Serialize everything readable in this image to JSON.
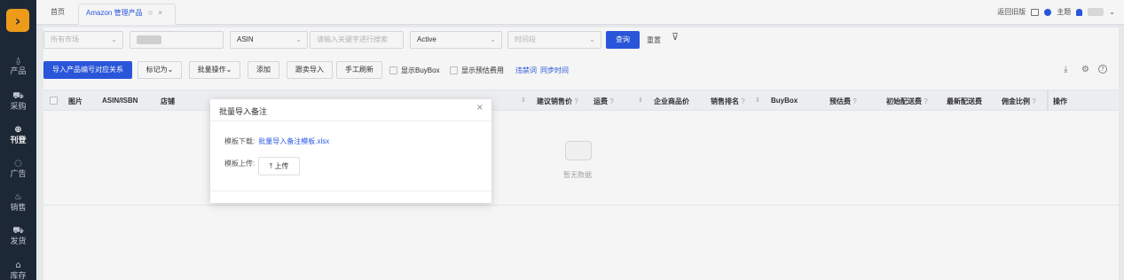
{
  "sidebar": {
    "logo_icon": "brand-logo-icon",
    "items": [
      {
        "label": "产品",
        "icon": "box-icon",
        "glyph": "⍙"
      },
      {
        "label": "采购",
        "icon": "cart-icon",
        "glyph": "⛟"
      },
      {
        "label": "刊登",
        "icon": "publish-icon",
        "glyph": "⊕",
        "active": true
      },
      {
        "label": "广告",
        "icon": "ad-icon",
        "glyph": "◌"
      },
      {
        "label": "销售",
        "icon": "sales-icon",
        "glyph": "♨"
      },
      {
        "label": "发货",
        "icon": "ship-icon",
        "glyph": "⛟"
      },
      {
        "label": "库存",
        "icon": "stock-icon",
        "glyph": "⌂"
      }
    ]
  },
  "tabs": {
    "home": "首页",
    "current": "Amazon 管理产品",
    "star_glyph": "☆",
    "close_glyph": "×"
  },
  "topright": {
    "back_old": "返回旧版",
    "theme": "主题",
    "dropdown_glyph": "⌄"
  },
  "filters": {
    "market_placeholder": "所有市场",
    "search_type": "ASIN",
    "keyword_placeholder": "请输入关键字进行搜索",
    "status": "Active",
    "time_placeholder": "时间段",
    "caret": "⌄",
    "query": "查询",
    "reset": "重置"
  },
  "toolbar": {
    "import_relation": "导入产品编号对应关系",
    "mark_as": "标记为",
    "batch_ops": "批量操作",
    "add": "添加",
    "follow_import": "跟卖导入",
    "manual_refresh": "手工刷新",
    "show_buybox": "显示BuyBox",
    "show_fee": "显示预估费用",
    "link_violation": "违禁词",
    "link_sync_time": "同步时间",
    "dropdown_arrow": "⌄",
    "download_icon_glyph": "⤓",
    "settings_icon_glyph": "⚙",
    "help_icon_glyph": "?"
  },
  "table": {
    "columns": {
      "image": "图片",
      "asin": "ASIN/ISBN",
      "shop": "店铺",
      "suggest_price": "建议销售价",
      "shipping": "运费",
      "biz_price": "企业商品价",
      "rank": "销售排名",
      "buybox": "BuyBox",
      "est_fee": "预估费",
      "init_delivery": "初始配送费",
      "latest_delivery": "最新配送费",
      "commission": "佣金比例",
      "actions": "操作"
    },
    "help_glyph": "?",
    "sort_glyph": "⇕",
    "empty_text": "暂无数据"
  },
  "dialog": {
    "title": "批量导入备注",
    "close": "×",
    "template_label": "模板下载:",
    "template_link": "批量导入备注模板.xlsx",
    "upload_label": "模板上传:",
    "upload_button": "⤒ 上传"
  }
}
